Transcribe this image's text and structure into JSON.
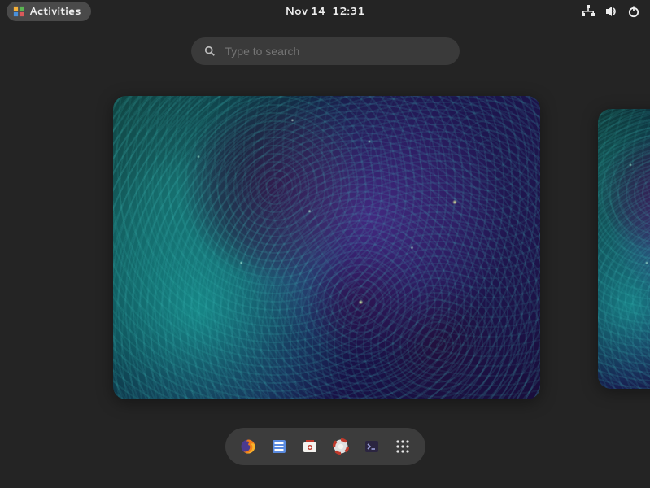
{
  "topbar": {
    "activities_label": "Activities",
    "date": "Nov 14",
    "time": "12:31"
  },
  "search": {
    "placeholder": "Type to search"
  },
  "status": {
    "network_icon": "wired-network-icon",
    "volume_icon": "volume-icon",
    "power_icon": "power-icon"
  },
  "dock": {
    "apps": [
      {
        "name": "firefox"
      },
      {
        "name": "files"
      },
      {
        "name": "software"
      },
      {
        "name": "help"
      },
      {
        "name": "terminal"
      },
      {
        "name": "show-apps"
      }
    ]
  }
}
